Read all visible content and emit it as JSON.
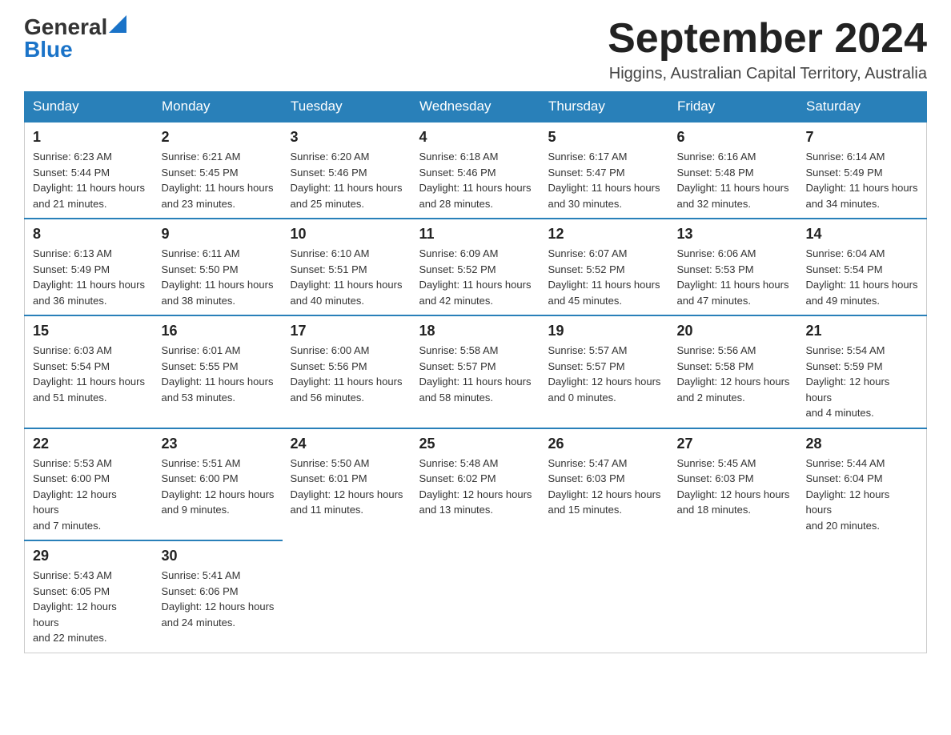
{
  "logo": {
    "general": "General",
    "blue": "Blue"
  },
  "title": "September 2024",
  "subtitle": "Higgins, Australian Capital Territory, Australia",
  "days_of_week": [
    "Sunday",
    "Monday",
    "Tuesday",
    "Wednesday",
    "Thursday",
    "Friday",
    "Saturday"
  ],
  "weeks": [
    [
      {
        "day": "1",
        "sunrise": "6:23 AM",
        "sunset": "5:44 PM",
        "daylight": "11 hours and 21 minutes."
      },
      {
        "day": "2",
        "sunrise": "6:21 AM",
        "sunset": "5:45 PM",
        "daylight": "11 hours and 23 minutes."
      },
      {
        "day": "3",
        "sunrise": "6:20 AM",
        "sunset": "5:46 PM",
        "daylight": "11 hours and 25 minutes."
      },
      {
        "day": "4",
        "sunrise": "6:18 AM",
        "sunset": "5:46 PM",
        "daylight": "11 hours and 28 minutes."
      },
      {
        "day": "5",
        "sunrise": "6:17 AM",
        "sunset": "5:47 PM",
        "daylight": "11 hours and 30 minutes."
      },
      {
        "day": "6",
        "sunrise": "6:16 AM",
        "sunset": "5:48 PM",
        "daylight": "11 hours and 32 minutes."
      },
      {
        "day": "7",
        "sunrise": "6:14 AM",
        "sunset": "5:49 PM",
        "daylight": "11 hours and 34 minutes."
      }
    ],
    [
      {
        "day": "8",
        "sunrise": "6:13 AM",
        "sunset": "5:49 PM",
        "daylight": "11 hours and 36 minutes."
      },
      {
        "day": "9",
        "sunrise": "6:11 AM",
        "sunset": "5:50 PM",
        "daylight": "11 hours and 38 minutes."
      },
      {
        "day": "10",
        "sunrise": "6:10 AM",
        "sunset": "5:51 PM",
        "daylight": "11 hours and 40 minutes."
      },
      {
        "day": "11",
        "sunrise": "6:09 AM",
        "sunset": "5:52 PM",
        "daylight": "11 hours and 42 minutes."
      },
      {
        "day": "12",
        "sunrise": "6:07 AM",
        "sunset": "5:52 PM",
        "daylight": "11 hours and 45 minutes."
      },
      {
        "day": "13",
        "sunrise": "6:06 AM",
        "sunset": "5:53 PM",
        "daylight": "11 hours and 47 minutes."
      },
      {
        "day": "14",
        "sunrise": "6:04 AM",
        "sunset": "5:54 PM",
        "daylight": "11 hours and 49 minutes."
      }
    ],
    [
      {
        "day": "15",
        "sunrise": "6:03 AM",
        "sunset": "5:54 PM",
        "daylight": "11 hours and 51 minutes."
      },
      {
        "day": "16",
        "sunrise": "6:01 AM",
        "sunset": "5:55 PM",
        "daylight": "11 hours and 53 minutes."
      },
      {
        "day": "17",
        "sunrise": "6:00 AM",
        "sunset": "5:56 PM",
        "daylight": "11 hours and 56 minutes."
      },
      {
        "day": "18",
        "sunrise": "5:58 AM",
        "sunset": "5:57 PM",
        "daylight": "11 hours and 58 minutes."
      },
      {
        "day": "19",
        "sunrise": "5:57 AM",
        "sunset": "5:57 PM",
        "daylight": "12 hours and 0 minutes."
      },
      {
        "day": "20",
        "sunrise": "5:56 AM",
        "sunset": "5:58 PM",
        "daylight": "12 hours and 2 minutes."
      },
      {
        "day": "21",
        "sunrise": "5:54 AM",
        "sunset": "5:59 PM",
        "daylight": "12 hours and 4 minutes."
      }
    ],
    [
      {
        "day": "22",
        "sunrise": "5:53 AM",
        "sunset": "6:00 PM",
        "daylight": "12 hours and 7 minutes."
      },
      {
        "day": "23",
        "sunrise": "5:51 AM",
        "sunset": "6:00 PM",
        "daylight": "12 hours and 9 minutes."
      },
      {
        "day": "24",
        "sunrise": "5:50 AM",
        "sunset": "6:01 PM",
        "daylight": "12 hours and 11 minutes."
      },
      {
        "day": "25",
        "sunrise": "5:48 AM",
        "sunset": "6:02 PM",
        "daylight": "12 hours and 13 minutes."
      },
      {
        "day": "26",
        "sunrise": "5:47 AM",
        "sunset": "6:03 PM",
        "daylight": "12 hours and 15 minutes."
      },
      {
        "day": "27",
        "sunrise": "5:45 AM",
        "sunset": "6:03 PM",
        "daylight": "12 hours and 18 minutes."
      },
      {
        "day": "28",
        "sunrise": "5:44 AM",
        "sunset": "6:04 PM",
        "daylight": "12 hours and 20 minutes."
      }
    ],
    [
      {
        "day": "29",
        "sunrise": "5:43 AM",
        "sunset": "6:05 PM",
        "daylight": "12 hours and 22 minutes."
      },
      {
        "day": "30",
        "sunrise": "5:41 AM",
        "sunset": "6:06 PM",
        "daylight": "12 hours and 24 minutes."
      },
      null,
      null,
      null,
      null,
      null
    ]
  ],
  "labels": {
    "sunrise": "Sunrise:",
    "sunset": "Sunset:",
    "daylight": "Daylight:"
  }
}
